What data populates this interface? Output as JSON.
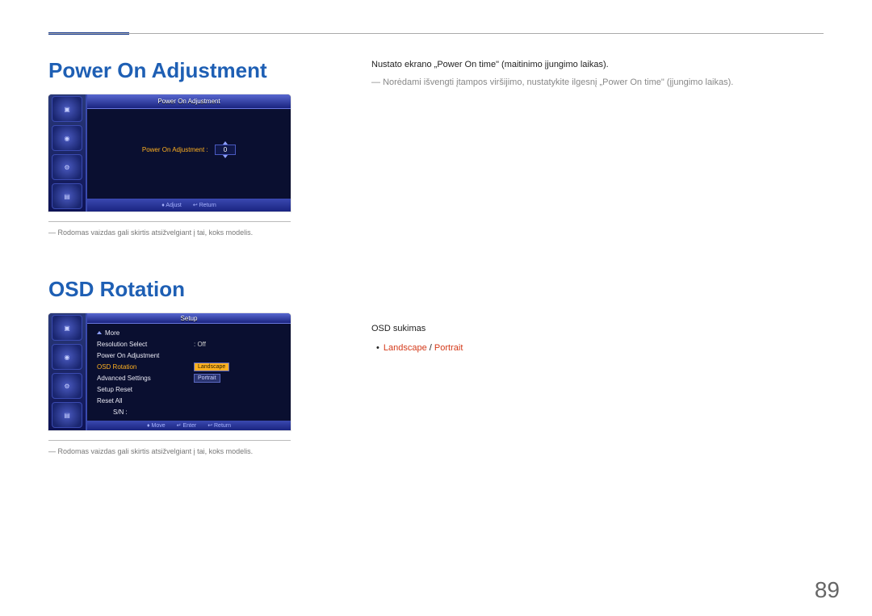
{
  "section1": {
    "heading": "Power On Adjustment",
    "body_text": "Nustato ekrano „Power On time\" (maitinimo įjungimo laikas).",
    "note": "Norėdami išvengti įtampos viršijimo, nustatykite ilgesnį „Power On time\" (įjungimo laikas).",
    "osd": {
      "title": "Power On Adjustment",
      "field_label": "Power On Adjustment :",
      "field_value": "0",
      "footer_adjust": "Adjust",
      "footer_return": "Return"
    },
    "caption": "Rodomas vaizdas gali skirtis atsižvelgiant į tai, koks modelis."
  },
  "section2": {
    "heading": "OSD Rotation",
    "body_text": "OSD sukimas",
    "option_landscape": "Landscape",
    "option_sep": " / ",
    "option_portrait": "Portrait",
    "osd": {
      "title": "Setup",
      "more": "More",
      "rows": {
        "resolution_label": "Resolution Select",
        "resolution_val": ": Off",
        "poweron_label": "Power On Adjustment",
        "osdrot_label": "OSD Rotation",
        "opt_landscape": "Landscape",
        "opt_portrait": "Portrait",
        "advanced_label": "Advanced Settings",
        "setupreset_label": "Setup Reset",
        "resetall_label": "Reset All",
        "sn_label": "S/N :"
      },
      "footer_move": "Move",
      "footer_enter": "Enter",
      "footer_return": "Return"
    },
    "caption": "Rodomas vaizdas gali skirtis atsižvelgiant į tai, koks modelis."
  },
  "page_number": "89"
}
